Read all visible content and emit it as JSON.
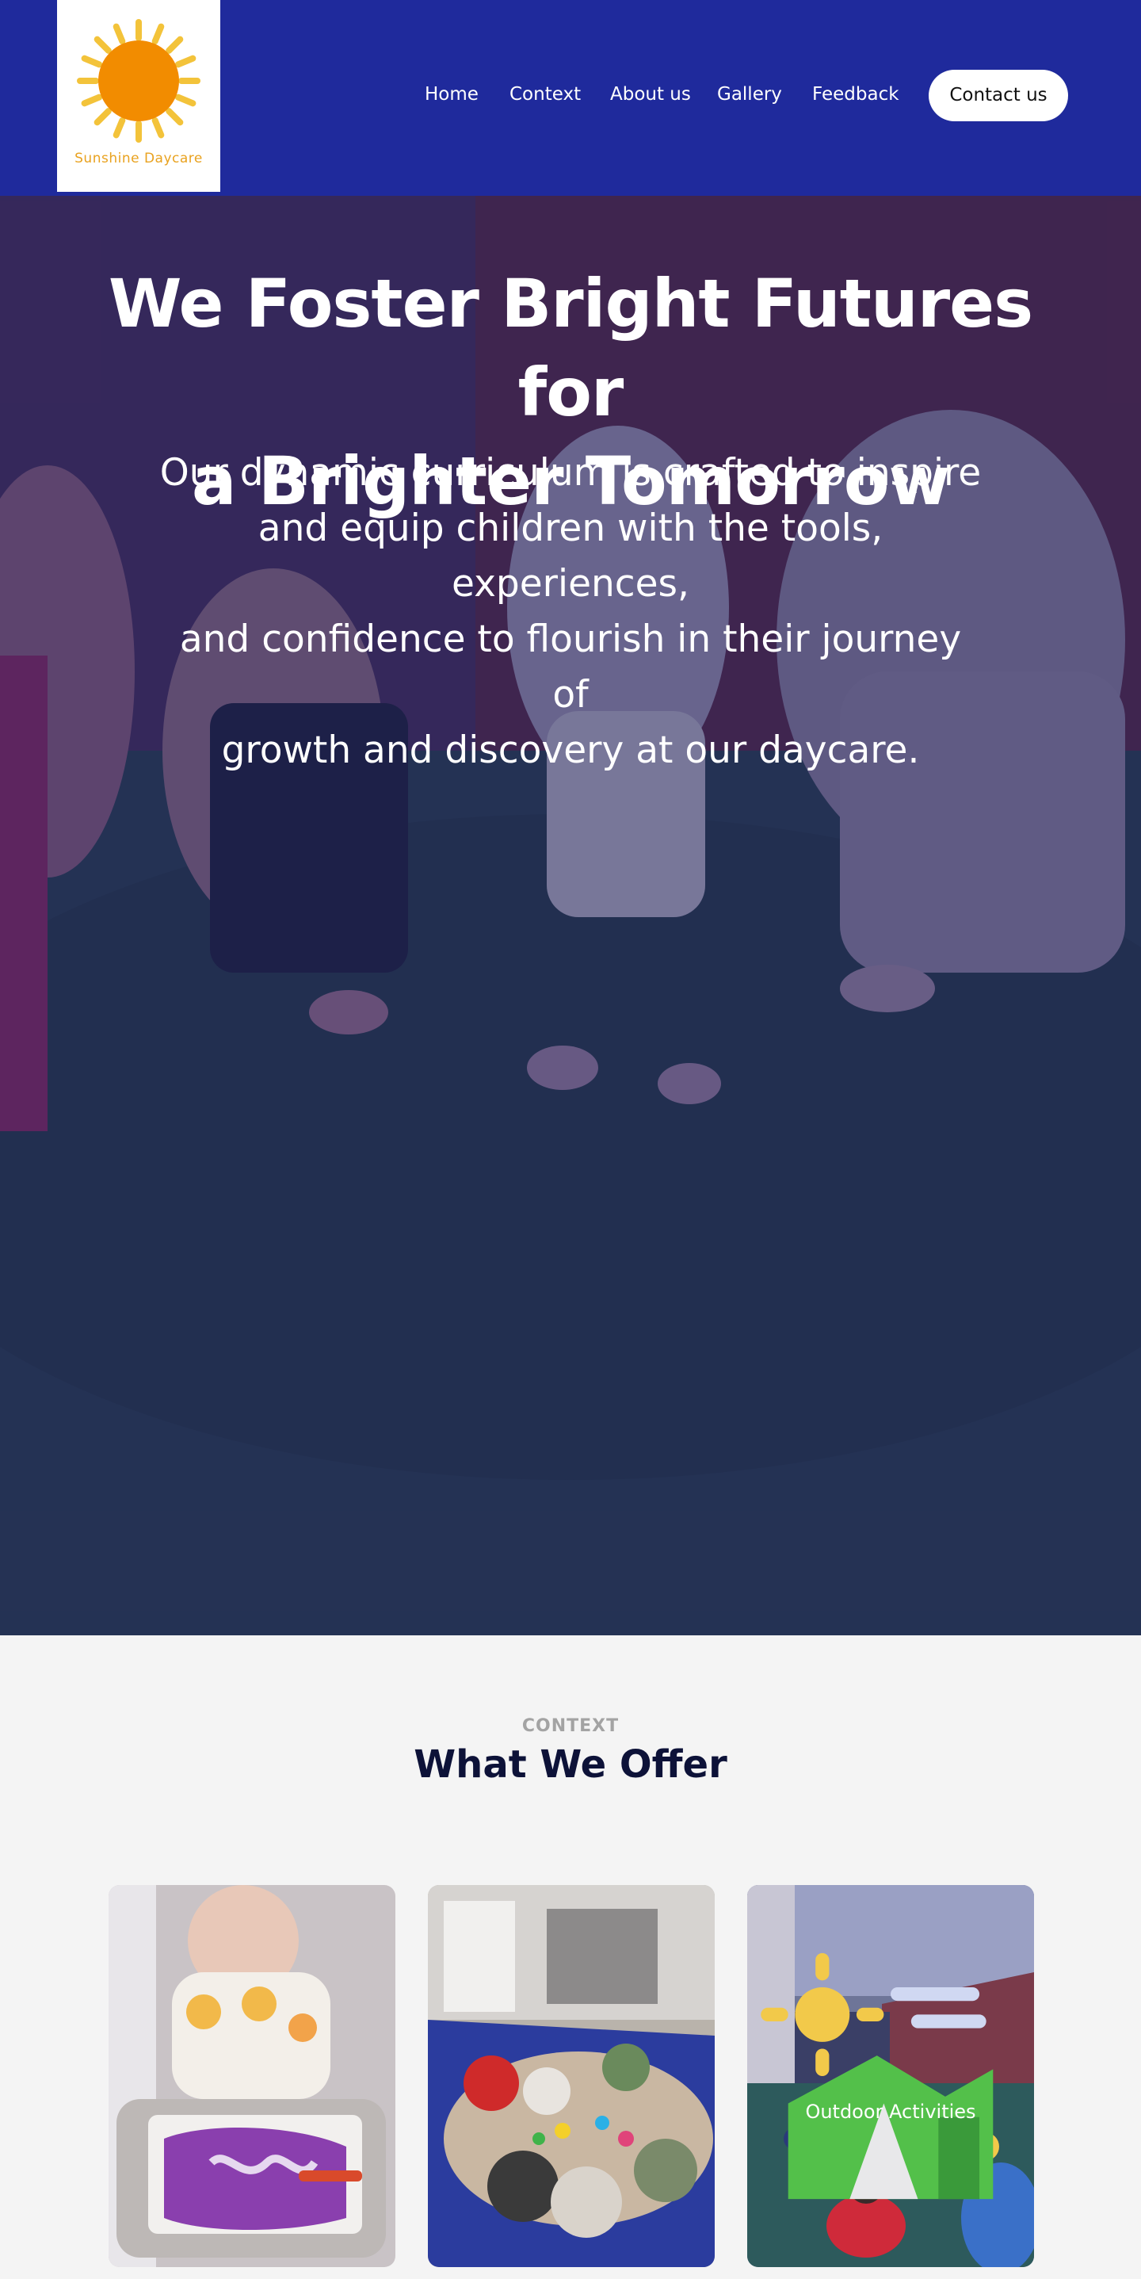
{
  "brand": {
    "name": "Sunshine Daycare",
    "logo_icon": "sun-icon",
    "sun_color": "#f28c00",
    "ray_color": "#f3c33a"
  },
  "nav": {
    "items": [
      {
        "label": "Home"
      },
      {
        "label": "Context"
      },
      {
        "label": "About us"
      },
      {
        "label": "Gallery"
      },
      {
        "label": "Feedback"
      }
    ],
    "contact_label": "Contact us"
  },
  "hero": {
    "title_line1": "We Foster Bright Futures for",
    "title_line2": "a Brighter Tomorrow",
    "subtitle_line1": "Our dynamic curriculum is crafted to inspire",
    "subtitle_line2": "and equip children with the tools, experiences,",
    "subtitle_line3": "and confidence to flourish in their journey of",
    "subtitle_line4": "growth and discovery at our daycare."
  },
  "context": {
    "eyebrow": "CONTEXT",
    "title": "What We Offer",
    "cards": [
      {
        "label": ""
      },
      {
        "label": ""
      },
      {
        "label": "Outdoor Activities",
        "icon": "outdoor-activities-icon"
      }
    ]
  },
  "colors": {
    "header_bg": "#1f2a9c",
    "title_dark": "#0d1238",
    "eyebrow_gray": "#a3a3a3"
  }
}
